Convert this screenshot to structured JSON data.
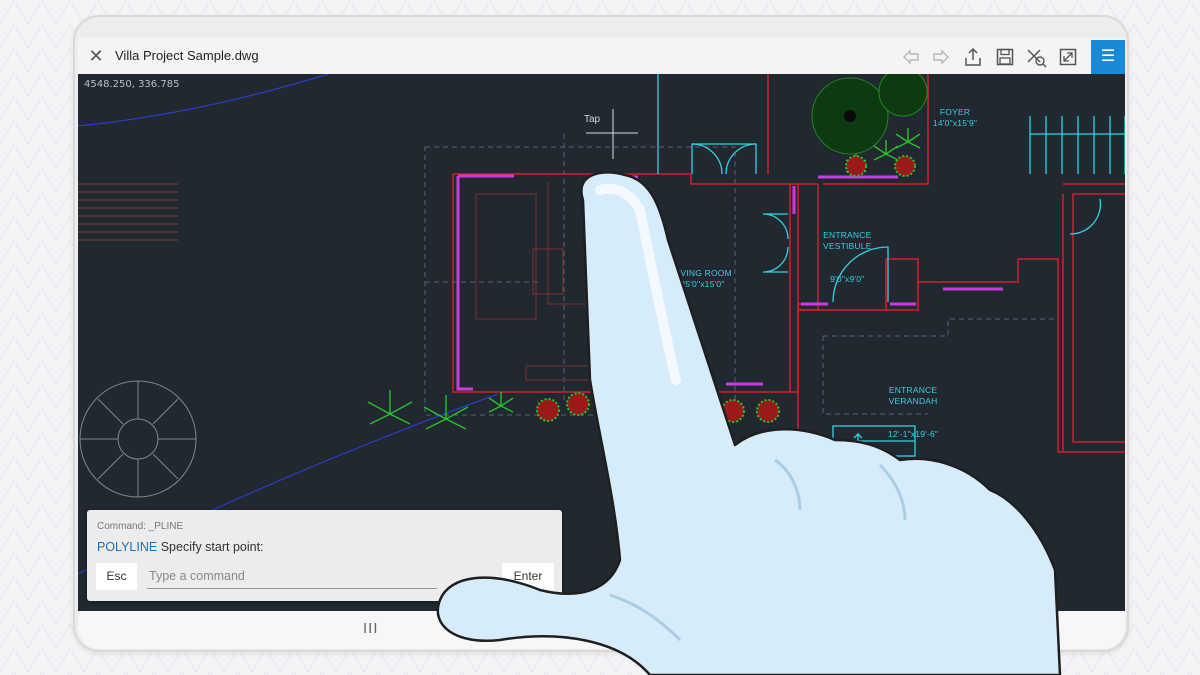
{
  "app": {
    "title": "Villa Project Sample.dwg"
  },
  "toolbar": {
    "icons": [
      "close-icon",
      "undo-icon",
      "redo-icon",
      "share-icon",
      "save-icon",
      "markup-icon",
      "fullscreen-icon",
      "hamburger-menu-icon"
    ]
  },
  "canvas": {
    "coordinates": "4548.250, 336.785",
    "tap_label": "Tap",
    "rooms": {
      "foyer": {
        "name": "FOYER",
        "size": "14'0\"x15'9\""
      },
      "living": {
        "name": "LIVING ROOM",
        "size": "25'0\"x15'0\""
      },
      "vestibule": {
        "name": "ENTRANCE\nVESTIBULE",
        "size": "9'0\"x9'0\""
      },
      "verandah": {
        "name": "ENTRANCE\nVERANDAH",
        "size": "12'-1\"x19'-6\""
      }
    }
  },
  "command": {
    "history": "Command: _PLINE",
    "prompt_keyword": "POLYLINE",
    "prompt_text": "Specify start point:",
    "esc_label": "Esc",
    "input_placeholder": "Type a command",
    "enter_label": "Enter"
  },
  "navbar": {
    "recent_glyph": "III"
  },
  "colors": {
    "canvas_bg": "#212830",
    "accent": "#1a8ad6",
    "wall_red": "#d0212b",
    "wall_magenta": "#c63de0",
    "cad_cyan": "#33d1e4",
    "plant_green": "#28c22a"
  }
}
